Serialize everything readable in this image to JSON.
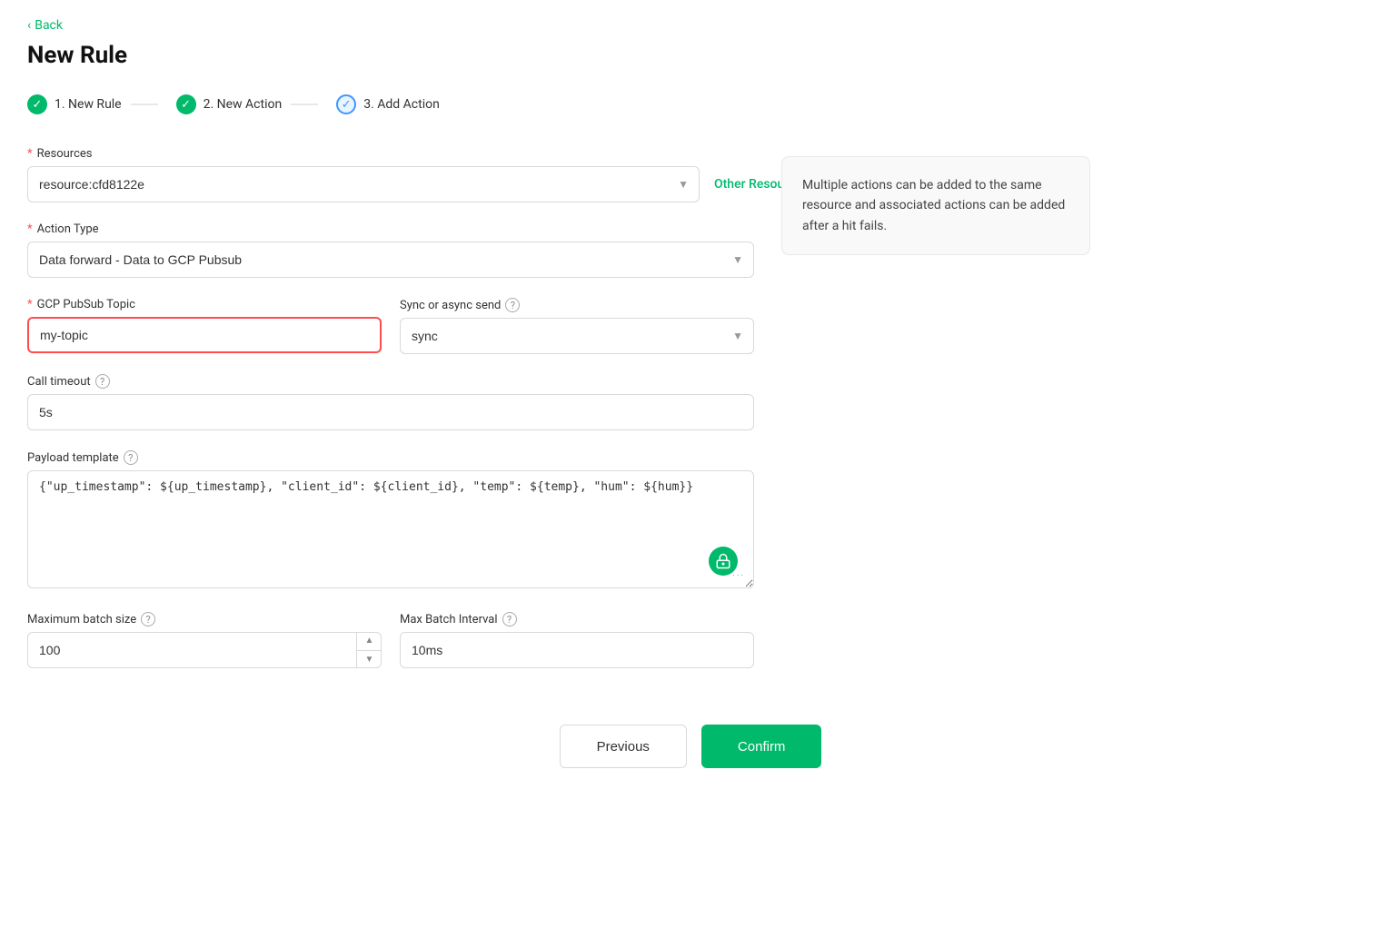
{
  "back": {
    "label": "Back"
  },
  "page": {
    "title": "New Rule"
  },
  "stepper": {
    "steps": [
      {
        "id": "step1",
        "label": "1. New Rule",
        "state": "complete"
      },
      {
        "id": "step2",
        "label": "2. New Action",
        "state": "complete"
      },
      {
        "id": "step3",
        "label": "3. Add Action",
        "state": "active"
      }
    ]
  },
  "form": {
    "resources_label": "Resources",
    "resources_value": "resource:cfd8122e",
    "other_resources_label": "Other Resources",
    "action_type_label": "Action Type",
    "action_type_placeholder": "Data forward - Data to GCP Pubsub",
    "gcp_topic_label": "GCP PubSub Topic",
    "gcp_topic_value": "my-topic",
    "sync_label": "Sync or async send",
    "sync_value": "sync",
    "call_timeout_label": "Call timeout",
    "call_timeout_value": "5s",
    "payload_label": "Payload template",
    "payload_value": "{\"up_timestamp\": ${up_timestamp}, \"client_id\": ${client_id}, \"temp\": ${temp}, \"hum\": ${hum}}",
    "max_batch_size_label": "Maximum batch size",
    "max_batch_size_value": "100",
    "max_batch_interval_label": "Max Batch Interval",
    "max_batch_interval_value": "10ms"
  },
  "info_card": {
    "text": "Multiple actions can be added to the same resource and associated actions can be added after a hit fails."
  },
  "buttons": {
    "previous": "Previous",
    "confirm": "Confirm"
  }
}
